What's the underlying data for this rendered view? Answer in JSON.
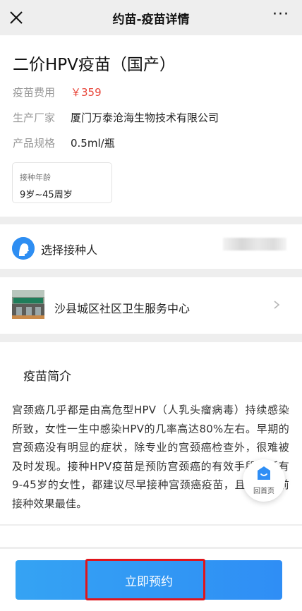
{
  "nav": {
    "title": "约苗-疫苗详情",
    "more": "···"
  },
  "vaccine": {
    "name": "二价HPV疫苗（国产）",
    "fee_label": "疫苗费用",
    "fee_value": "￥359",
    "maker_label": "生产厂家",
    "maker_value": "厦门万泰沧海生物技术有限公司",
    "spec_label": "产品规格",
    "spec_value": "0.5ml/瓶",
    "age_label": "接种年龄",
    "age_value": "9岁~45周岁"
  },
  "person": {
    "label": "选择接种人"
  },
  "clinic": {
    "name": "沙县城区社区卫生服务中心"
  },
  "intro": {
    "title": "疫苗简介",
    "body": "宫颈癌几乎都是由高危型HPV（人乳头瘤病毒）持续感染所致，女性一生中感染HPV的几率高达80%左右。早期的宫颈癌没有明显的症状，除专业的宫颈癌检查外，很难被及时发现。接种HPV疫苗是预防宫颈癌的有效手段，所有9-45岁的女性，都建议尽早接种宫颈癌疫苗，且性生活前接种效果最佳。"
  },
  "home": {
    "label": "回首页"
  },
  "action": {
    "book_label": "立即预约"
  },
  "colors": {
    "accent": "#2f8ef5",
    "price": "#e8463a",
    "highlight": "#e0151b"
  }
}
